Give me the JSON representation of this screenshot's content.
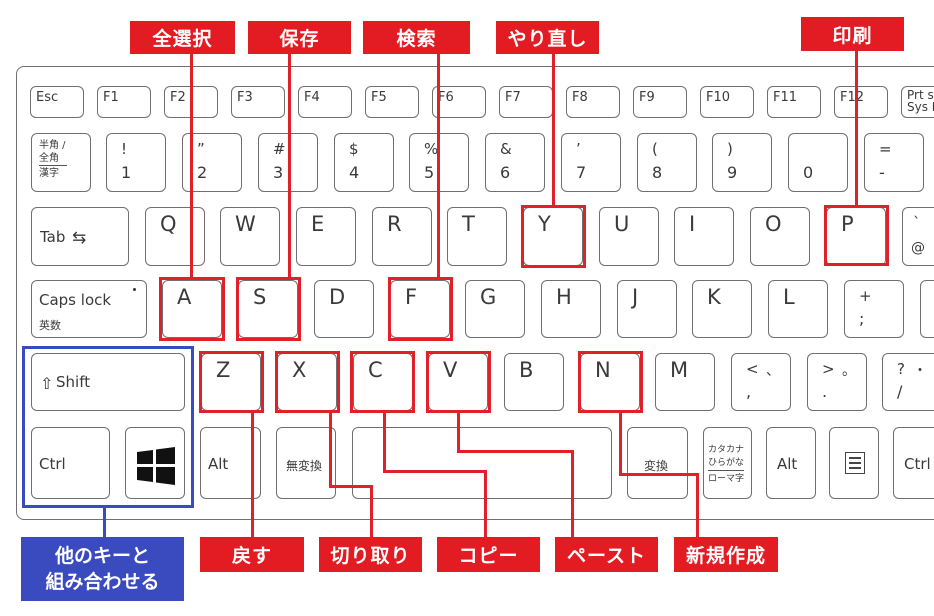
{
  "top_labels": {
    "select_all": "全選択",
    "save": "保存",
    "search": "検索",
    "redo": "やり直し",
    "print": "印刷"
  },
  "bottom_labels": {
    "modifier_line1": "他のキーと",
    "modifier_line2": "組み合わせる",
    "undo": "戻す",
    "cut": "切り取り",
    "copy": "コピー",
    "paste": "ペースト",
    "new": "新規作成"
  },
  "colors": {
    "highlight_red": "#e31b23",
    "highlight_blue": "#3a4bbf",
    "key_outline": "#6f6f6f"
  },
  "keys": {
    "function_row": [
      "Esc",
      "F1",
      "F2",
      "F3",
      "F4",
      "F5",
      "F6",
      "F7",
      "F8",
      "F9",
      "F10",
      "F11",
      "F12"
    ],
    "prtsc_line1": "Prt sc",
    "prtsc_line2": "Sys Rq",
    "hankaku_line1": "半角 /",
    "hankaku_line2": "全角",
    "hankaku_line3": "漢字",
    "number_row": [
      {
        "top": "!",
        "bottom": "1"
      },
      {
        "top": "”",
        "bottom": "2"
      },
      {
        "top": "#",
        "bottom": "3"
      },
      {
        "top": "$",
        "bottom": "4"
      },
      {
        "top": "%",
        "bottom": "5"
      },
      {
        "top": "&",
        "bottom": "6"
      },
      {
        "top": "’",
        "bottom": "7"
      },
      {
        "top": "(",
        "bottom": "8"
      },
      {
        "top": ")",
        "bottom": "9"
      },
      {
        "top": "",
        "bottom": "0"
      },
      {
        "top": "=",
        "bottom": "-"
      }
    ],
    "tab": "Tab",
    "tab_icon": "⇆",
    "q_row": [
      "Q",
      "W",
      "E",
      "R",
      "T",
      "Y",
      "U",
      "I",
      "O",
      "P"
    ],
    "at_top": "`",
    "at_bottom": "@",
    "caps_line1": "Caps lock",
    "caps_line2": "英数",
    "a_row": [
      "A",
      "S",
      "D",
      "F",
      "G",
      "H",
      "J",
      "K",
      "L"
    ],
    "semicolon_top": "+",
    "semicolon_bottom": ";",
    "shift": "Shift",
    "shift_icon": "⇧",
    "z_row": [
      "Z",
      "X",
      "C",
      "V",
      "B",
      "N",
      "M"
    ],
    "comma": {
      "top": "<",
      "right": "、",
      "bottom": ","
    },
    "period": {
      "top": ">",
      "right": "。",
      "bottom": "."
    },
    "slash": {
      "top": "?",
      "right": "・",
      "bottom": "/"
    },
    "ctrl_left": "Ctrl",
    "alt_left": "Alt",
    "muhenkan": "無変換",
    "henkan": "変換",
    "kana_line1": "カタカナ",
    "kana_line2": "ひらがな",
    "kana_line3": "ローマ字",
    "alt_right": "Alt",
    "ctrl_right": "Ctrl"
  }
}
